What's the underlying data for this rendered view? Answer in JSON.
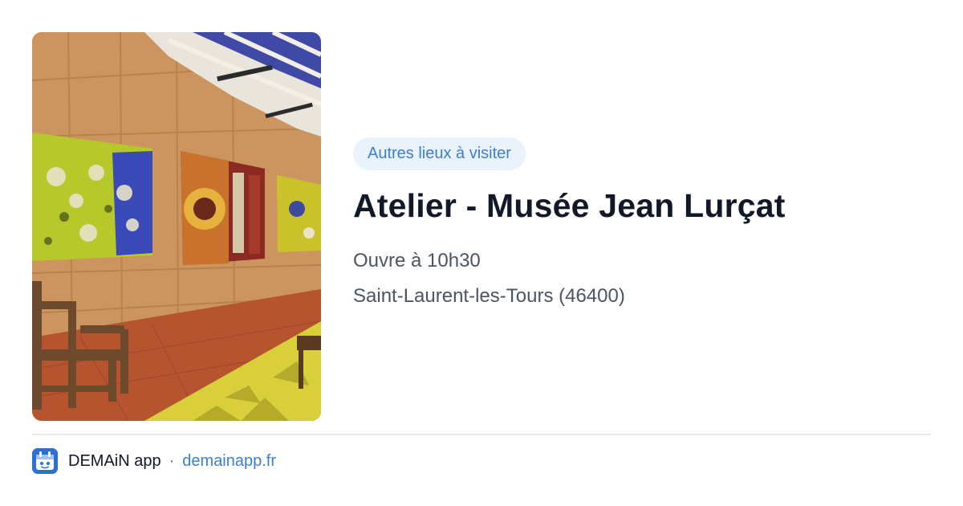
{
  "card": {
    "badge": "Autres lieux à visiter",
    "title": "Atelier - Musée Jean Lurçat",
    "hours": "Ouvre à 10h30",
    "location": "Saint-Laurent-les-Tours (46400)"
  },
  "image": {
    "description": "museum-interior-photo"
  },
  "footer": {
    "app_icon": "demain-app-icon",
    "app_name": "DEMAiN app",
    "separator": "·",
    "link": "demainapp.fr"
  },
  "colors": {
    "badge_bg": "#eaf2fc",
    "accent": "#3b7fd0",
    "title": "#111827",
    "muted": "#4b5563",
    "divider": "#e3e8ee",
    "app_icon": "#2e6fd6"
  }
}
